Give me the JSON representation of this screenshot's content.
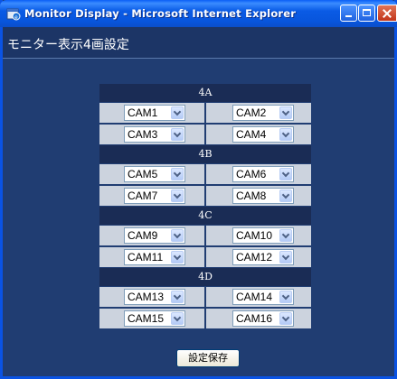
{
  "window": {
    "title": "Monitor Display - Microsoft Internet Explorer"
  },
  "page": {
    "title": "モニター表示4画設定"
  },
  "groups": [
    {
      "label": "4A",
      "rows": [
        [
          "CAM1",
          "CAM2"
        ],
        [
          "CAM3",
          "CAM4"
        ]
      ]
    },
    {
      "label": "4B",
      "rows": [
        [
          "CAM5",
          "CAM6"
        ],
        [
          "CAM7",
          "CAM8"
        ]
      ]
    },
    {
      "label": "4C",
      "rows": [
        [
          "CAM9",
          "CAM10"
        ],
        [
          "CAM11",
          "CAM12"
        ]
      ]
    },
    {
      "label": "4D",
      "rows": [
        [
          "CAM13",
          "CAM14"
        ],
        [
          "CAM15",
          "CAM16"
        ]
      ]
    }
  ],
  "save_button": {
    "label": "設定保存"
  }
}
